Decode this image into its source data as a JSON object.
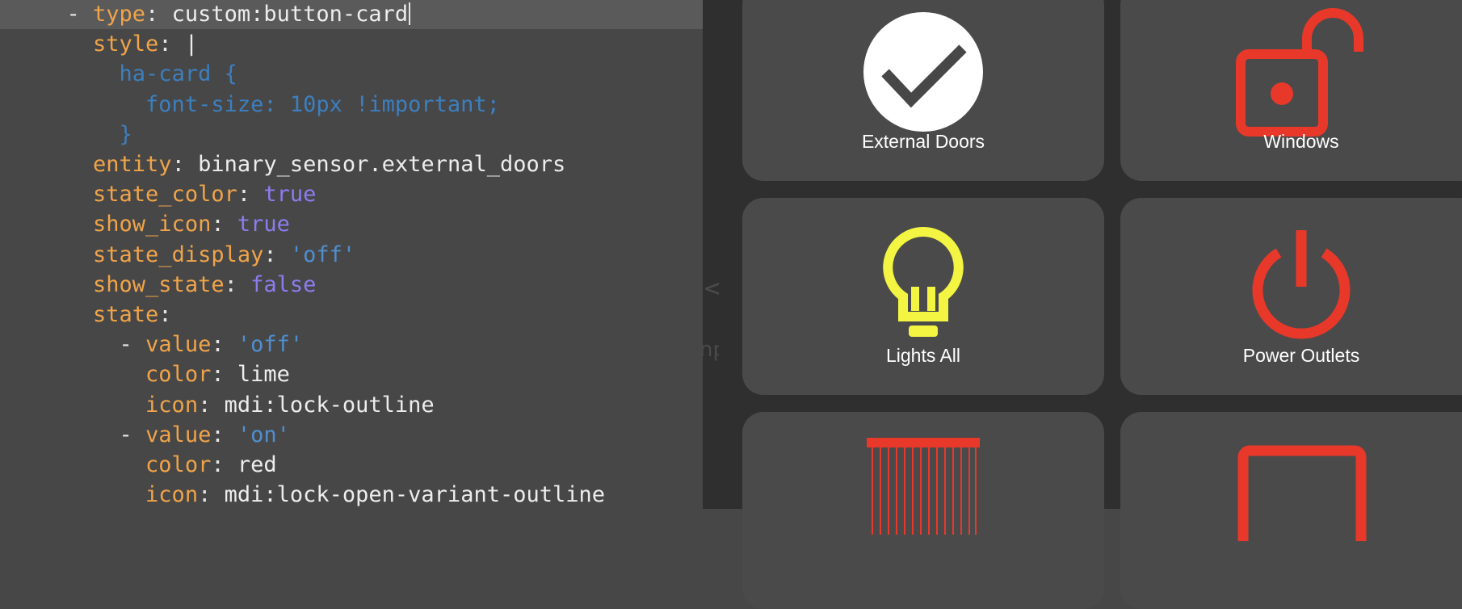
{
  "editor": {
    "lines": [
      {
        "indent": "  ",
        "dash": "- ",
        "key": "type",
        "value": "custom:button-card",
        "value_type": "plain",
        "caret": true
      },
      {
        "indent": "    ",
        "key": "style",
        "value": "|",
        "value_type": "plain"
      },
      {
        "indent": "      ",
        "text": "ha-card {",
        "value_type": "css"
      },
      {
        "indent": "        ",
        "text": "font-size: 10px !important;",
        "value_type": "css"
      },
      {
        "indent": "      ",
        "text": "}",
        "value_type": "css"
      },
      {
        "indent": "    ",
        "key": "entity",
        "value": "binary_sensor.external_doors",
        "value_type": "plain"
      },
      {
        "indent": "    ",
        "key": "state_color",
        "value": "true",
        "value_type": "bool"
      },
      {
        "indent": "    ",
        "key": "show_icon",
        "value": "true",
        "value_type": "bool"
      },
      {
        "indent": "    ",
        "key": "state_display",
        "value": "'off'",
        "value_type": "string"
      },
      {
        "indent": "    ",
        "key": "show_state",
        "value": "false",
        "value_type": "bool"
      },
      {
        "indent": "    ",
        "key": "state",
        "value": "",
        "value_type": "plain"
      },
      {
        "indent": "      ",
        "dash": "- ",
        "key": "value",
        "value": "'off'",
        "value_type": "string"
      },
      {
        "indent": "        ",
        "key": "color",
        "value": "lime",
        "value_type": "plain"
      },
      {
        "indent": "        ",
        "key": "icon",
        "value": "mdi:lock-outline",
        "value_type": "plain"
      },
      {
        "indent": "      ",
        "dash": "- ",
        "key": "value",
        "value": "'on'",
        "value_type": "string"
      },
      {
        "indent": "        ",
        "key": "color",
        "value": "red",
        "value_type": "plain"
      },
      {
        "indent": "        ",
        "key": "icon",
        "value": "mdi:lock-open-variant-outline",
        "value_type": "plain"
      }
    ]
  },
  "preview": {
    "cards": [
      {
        "label": "External Doors",
        "icon": "check-circle-icon",
        "icon_color": "#ffffff"
      },
      {
        "label": "Windows",
        "icon": "lock-open-variant-outline-icon",
        "icon_color": "#e8382a"
      },
      {
        "label": "Lights All",
        "icon": "lightbulb-outline-icon",
        "icon_color": "#f3f542"
      },
      {
        "label": "Power Outlets",
        "icon": "power-icon",
        "icon_color": "#e8382a"
      },
      {
        "label": "",
        "icon": "blinds-icon",
        "icon_color": "#e8382a"
      },
      {
        "label": "",
        "icon": "window-outline-icon",
        "icon_color": "#e8382a"
      }
    ]
  },
  "colors": {
    "yaml_key": "#f0a44a",
    "yaml_bool": "#8b7cf0",
    "yaml_string": "#4f8fd0",
    "icon_red": "#e8382a",
    "icon_yellow": "#f3f542"
  }
}
